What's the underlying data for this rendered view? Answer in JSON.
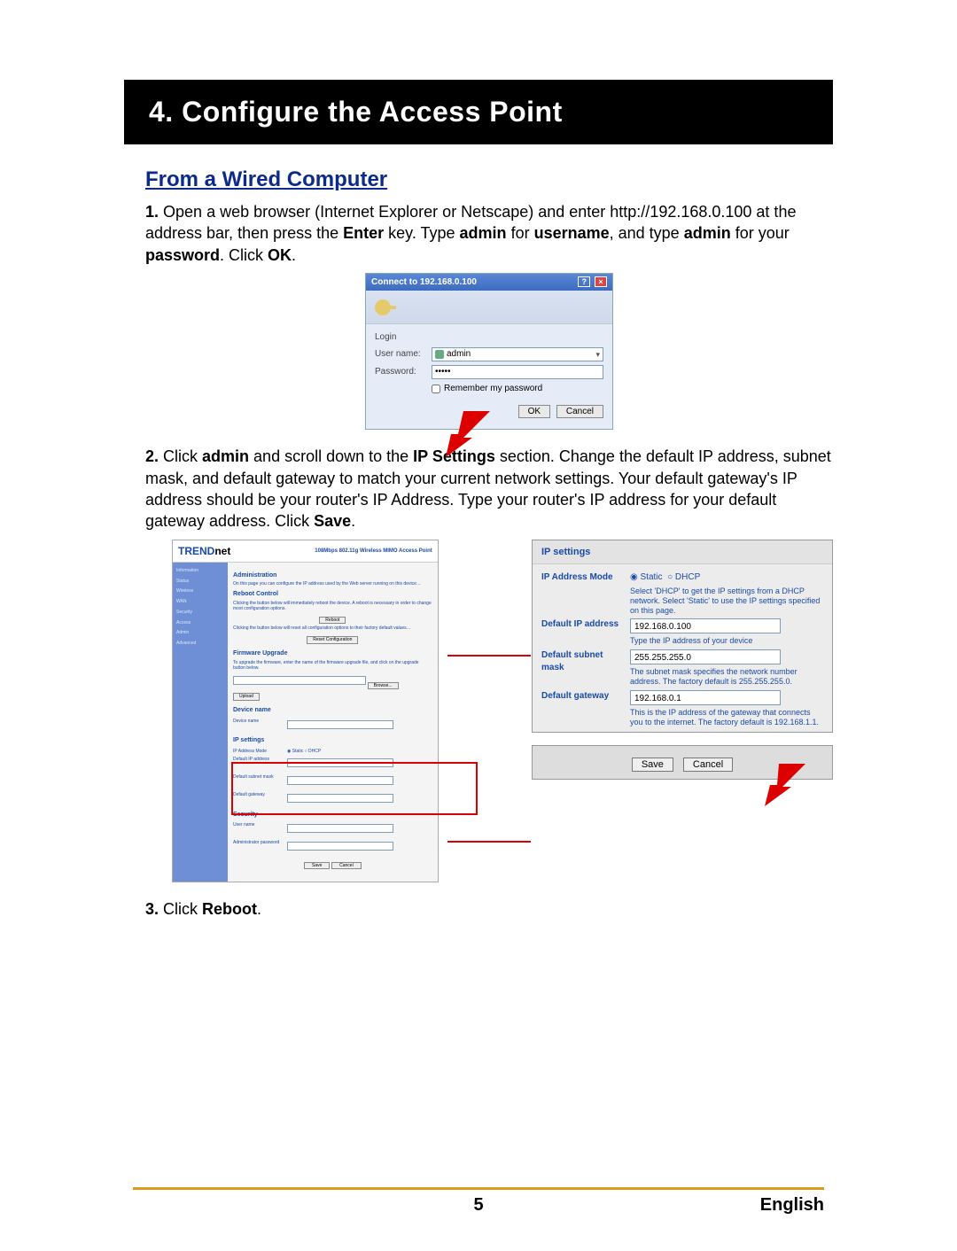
{
  "header": {
    "title": "4. Configure the Access Point"
  },
  "subhead": "From a Wired Computer",
  "step1": {
    "num": "1.",
    "p1": "Open a web browser (Internet Explorer or Netscape) and enter http://192.168.0.100 at the address bar, then press the ",
    "b1": "Enter",
    "p2": " key.  Type ",
    "b2": "admin",
    "p3": " for ",
    "b3": "username",
    "p4": ", and type ",
    "b4": "admin",
    "p5": " for your ",
    "b5": "password",
    "p6": ". Click ",
    "b6": "OK",
    "p7": "."
  },
  "login": {
    "title": "Connect to 192.168.0.100",
    "login_label": "Login",
    "user_label": "User name:",
    "pass_label": "Password:",
    "user_value": "admin",
    "pass_value": "•••••",
    "remember": "Remember my password",
    "ok": "OK",
    "cancel": "Cancel"
  },
  "step2": {
    "num": "2.",
    "p1": "Click ",
    "b1": "admin",
    "p2": " and scroll down to the ",
    "b2": "IP Settings",
    "p3": " section.  Change the default IP address, subnet mask, and default gateway to match your current network settings.  Your default gateway's IP address should be your router's IP Address.  Type your router's IP address for your default gateway address. Click ",
    "b3": "Save",
    "p4": "."
  },
  "admin": {
    "brand_a": "TREND",
    "brand_b": "net",
    "product": "108Mbps 802.11g Wireless MIMO Access Point",
    "sidebar": [
      "Information",
      "Status",
      "Wireless",
      "WAN",
      "Security",
      "Access",
      "Admin",
      "Advanced"
    ],
    "admin_title": "Administration",
    "reboot_title": "Reboot Control",
    "reboot_btn": "Reboot",
    "reset_btn": "Reset Configuration",
    "fw_title": "Firmware Upgrade",
    "browse_btn": "Browse...",
    "upload_btn": "Upload",
    "device_title": "Device name",
    "ip_title": "IP settings",
    "sec_title": "Security",
    "save": "Save",
    "cancel": "Cancel"
  },
  "ipzoom": {
    "title": "IP settings",
    "mode_label": "IP Address Mode",
    "static": "Static",
    "dhcp": "DHCP",
    "mode_hint": "Select 'DHCP' to get the IP settings from a DHCP network. Select 'Static' to use the IP settings specified on this page.",
    "ip_label": "Default IP address",
    "ip_value": "192.168.0.100",
    "ip_hint": "Type the IP address of your device",
    "mask_label": "Default subnet mask",
    "mask_value": "255.255.255.0",
    "mask_hint": "The subnet mask specifies the network number address. The factory default is 255.255.255.0.",
    "gw_label": "Default gateway",
    "gw_value": "192.168.0.1",
    "gw_hint": "This is the IP address of the gateway that connects you to the internet. The factory default is 192.168.1.1.",
    "save": "Save",
    "cancel": "Cancel"
  },
  "step3": {
    "num": "3.",
    "p1": "Click ",
    "b1": "Reboot",
    "p2": "."
  },
  "footer": {
    "page": "5",
    "lang": "English"
  }
}
